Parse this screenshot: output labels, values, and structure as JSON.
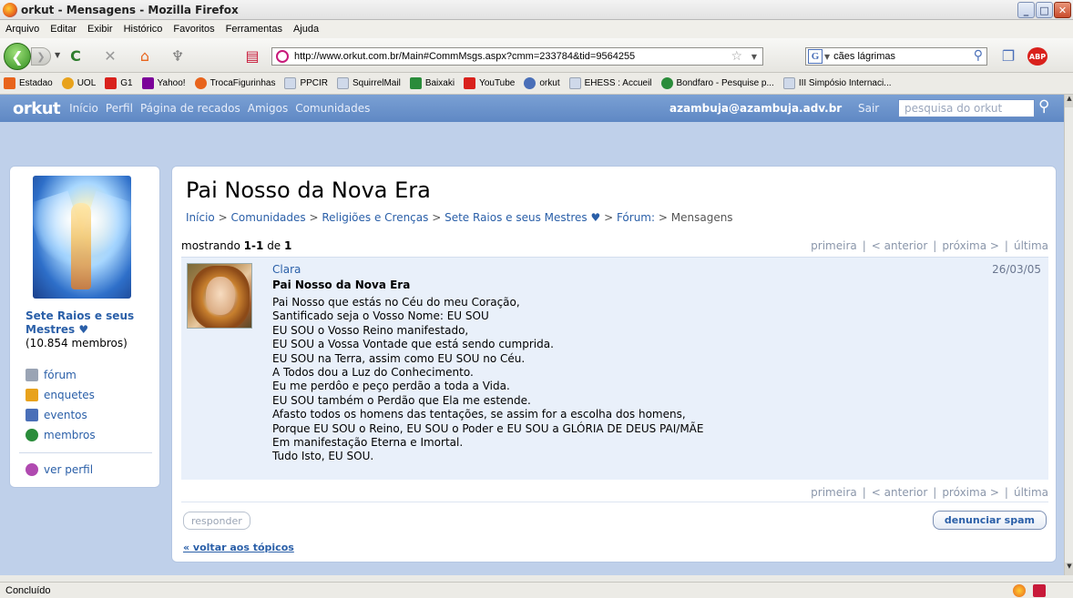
{
  "window": {
    "title": "orkut - Mensagens - Mozilla Firefox",
    "controls": [
      "_",
      "□",
      "✕"
    ]
  },
  "menu": [
    "Arquivo",
    "Editar",
    "Exibir",
    "Histórico",
    "Favoritos",
    "Ferramentas",
    "Ajuda"
  ],
  "navbar": {
    "url": "http://www.orkut.com.br/Main#CommMsgs.aspx?cmm=233784&tid=9564255",
    "search_value": "cães lágrimas",
    "search_engine_label": "G",
    "adblock_label": "ABP"
  },
  "bookmarks": [
    {
      "label": "Estadao",
      "color": "#e8641c"
    },
    {
      "label": "UOL",
      "color": "#e8a21c"
    },
    {
      "label": "G1",
      "color": "#d9211c"
    },
    {
      "label": "Yahoo!",
      "color": "#7b0099"
    },
    {
      "label": "TrocaFigurinhas",
      "color": "#e8641c"
    },
    {
      "label": "PPCIR",
      "color": "#cfd9ea"
    },
    {
      "label": "SquirrelMail",
      "color": "#cfd9ea"
    },
    {
      "label": "Baixaki",
      "color": "#2a8c3a"
    },
    {
      "label": "YouTube",
      "color": "#d9211c"
    },
    {
      "label": "orkut",
      "color": "#4a6fb8"
    },
    {
      "label": "EHESS : Accueil",
      "color": "#cfd9ea"
    },
    {
      "label": "Bondfaro - Pesquise p...",
      "color": "#2a8c3a"
    },
    {
      "label": "III Simpósio Internaci...",
      "color": "#cfd9ea"
    }
  ],
  "orkut_bar": {
    "logo": "orkut",
    "links": [
      "Início",
      "Perfil",
      "Página de recados",
      "Amigos",
      "Comunidades"
    ],
    "email": "azambuja@azambuja.adv.br",
    "logout": "Sair",
    "search_placeholder": "pesquisa do orkut"
  },
  "community": {
    "name": "Sete Raios e seus Mestres ♥",
    "members": "(10.854 membros)",
    "links": [
      {
        "label": "fórum",
        "icon": "forum-icon",
        "color": "#9aa4b4"
      },
      {
        "label": "enquetes",
        "icon": "poll-icon",
        "color": "#e8a21c"
      },
      {
        "label": "eventos",
        "icon": "calendar-icon",
        "color": "#4a6fb8"
      },
      {
        "label": "membros",
        "icon": "members-icon",
        "color": "#2a8c3a"
      }
    ],
    "profile_link": "ver perfil"
  },
  "topic": {
    "title": "Pai Nosso da Nova Era",
    "breadcrumb": [
      "Início",
      "Comunidades",
      "Religiões e Crenças",
      "Sete Raios e seus Mestres ♥",
      "Fórum:",
      "Mensagens"
    ],
    "showing_prefix": "mostrando",
    "showing_range": "1-1",
    "showing_of": "de",
    "showing_total": "1"
  },
  "pager": {
    "first": "primeira",
    "prev": "< anterior",
    "next": "próxima >",
    "last": "última"
  },
  "message": {
    "author": "Clara",
    "date": "26/03/05",
    "subject": "Pai Nosso da Nova Era",
    "body": "Pai Nosso que estás no Céu do meu Coração,\nSantificado seja o Vosso Nome: EU SOU\nEU SOU o Vosso Reino manifestado,\nEU SOU a Vossa Vontade que está sendo cumprida.\nEU SOU na Terra, assim como EU SOU no Céu.\nA Todos dou a Luz do Conhecimento.\nEu me perdôo e peço perdão a toda a Vida.\nEU SOU também o Perdão que Ela me estende.\nAfasto todos os homens das tentações, se assim for a escolha dos homens,\nPorque EU SOU o Reino, EU SOU o Poder e EU SOU a GLÓRIA DE DEUS PAI/MÃE\nEm manifestação Eterna e Imortal.\nTudo Isto, EU SOU."
  },
  "actions": {
    "reply": "responder",
    "report_spam": "denunciar spam",
    "back_to_topics": "« voltar aos tópicos"
  },
  "status": {
    "text": "Concluído"
  }
}
